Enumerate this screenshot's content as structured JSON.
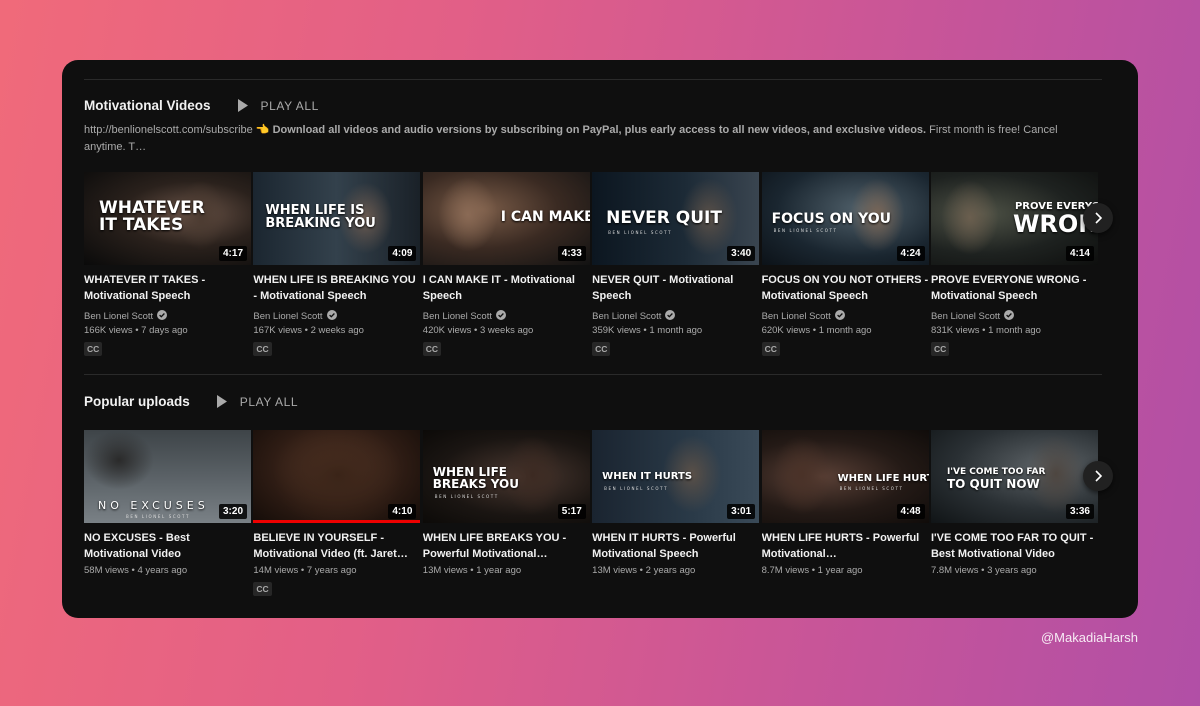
{
  "shelves": [
    {
      "title": "Motivational Videos",
      "play_all": "PLAY ALL",
      "description_link": "http://benlionelscott.com/subscribe",
      "description_emoji": "👈",
      "description_bold": "Download all videos and audio versions by subscribing on PayPal, plus early access to all new videos, and exclusive videos.",
      "description_rest": " First month is free! Cancel anytime. T…",
      "videos": [
        {
          "title": "WHATEVER IT TAKES - Motivational Speech",
          "duration": "4:17",
          "channel": "Ben Lionel Scott",
          "meta": "166K views • 7 days ago",
          "cc": "CC",
          "thumb_text": "WHATEVER\nIT TAKES"
        },
        {
          "title": "WHEN LIFE IS BREAKING YOU - Motivational Speech",
          "duration": "4:09",
          "channel": "Ben Lionel Scott",
          "meta": "167K views • 2 weeks ago",
          "cc": "CC",
          "thumb_text": "WHEN LIFE IS\nBREAKING YOU"
        },
        {
          "title": "I CAN MAKE IT - Motivational Speech",
          "duration": "4:33",
          "channel": "Ben Lionel Scott",
          "meta": "420K views • 3 weeks ago",
          "cc": "CC",
          "thumb_text": "I CAN MAKE IT"
        },
        {
          "title": "NEVER QUIT - Motivational Speech",
          "duration": "3:40",
          "channel": "Ben Lionel Scott",
          "meta": "359K views • 1 month ago",
          "cc": "CC",
          "thumb_text": "NEVER QUIT",
          "thumb_sub": "BEN LIONEL SCOTT"
        },
        {
          "title": "FOCUS ON YOU NOT OTHERS - Motivational Speech",
          "duration": "4:24",
          "channel": "Ben Lionel Scott",
          "meta": "620K views • 1 month ago",
          "cc": "CC",
          "thumb_text": "FOCUS ON YOU",
          "thumb_sub": "BEN LIONEL SCOTT"
        },
        {
          "title": "PROVE EVERYONE WRONG - Motivational Speech",
          "duration": "4:14",
          "channel": "Ben Lionel Scott",
          "meta": "831K views • 1 month ago",
          "cc": "CC",
          "thumb_text": "PROVE EVERYONE",
          "thumb_text_big": "WRONG"
        }
      ]
    },
    {
      "title": "Popular uploads",
      "play_all": "PLAY ALL",
      "videos": [
        {
          "title": "NO EXCUSES - Best Motivational Video",
          "duration": "3:20",
          "meta": "58M views • 4 years ago",
          "thumb_text": "NO EXCUSES",
          "thumb_sub": "BEN LIONEL SCOTT"
        },
        {
          "title": "BELIEVE IN YOURSELF - Motivational Video (ft. Jaret…",
          "duration": "4:10",
          "meta": "14M views • 7 years ago",
          "cc": "CC",
          "progress": 1.0
        },
        {
          "title": "WHEN LIFE BREAKS YOU - Powerful Motivational…",
          "duration": "5:17",
          "meta": "13M views • 1 year ago",
          "thumb_text": "WHEN LIFE\nBREAKS YOU",
          "thumb_sub": "BEN LIONEL SCOTT"
        },
        {
          "title": "WHEN IT HURTS - Powerful Motivational Speech",
          "duration": "3:01",
          "meta": "13M views • 2 years ago",
          "thumb_text": "WHEN IT HURTS",
          "thumb_sub": "BEN LIONEL SCOTT"
        },
        {
          "title": "WHEN LIFE HURTS - Powerful Motivational…",
          "duration": "4:48",
          "meta": "8.7M views • 1 year ago",
          "thumb_text": "WHEN LIFE HURTS",
          "thumb_sub": "BEN LIONEL SCOTT"
        },
        {
          "title": "I'VE COME TOO FAR TO QUIT - Best Motivational Video",
          "duration": "3:36",
          "meta": "7.8M views • 3 years ago",
          "thumb_text": "I'VE COME TOO FAR",
          "thumb_text_big": "TO QUIT NOW"
        }
      ]
    }
  ],
  "watermark": "@MakadiaHarsh",
  "icons": {
    "play": "play-icon",
    "verified": "verified-check-icon",
    "next": "chevron-right-icon"
  },
  "colors": {
    "card_bg": "#0f0f0f",
    "text_primary": "#f1f1f1",
    "text_secondary": "#aaaaaa",
    "progress": "#ee0000"
  }
}
